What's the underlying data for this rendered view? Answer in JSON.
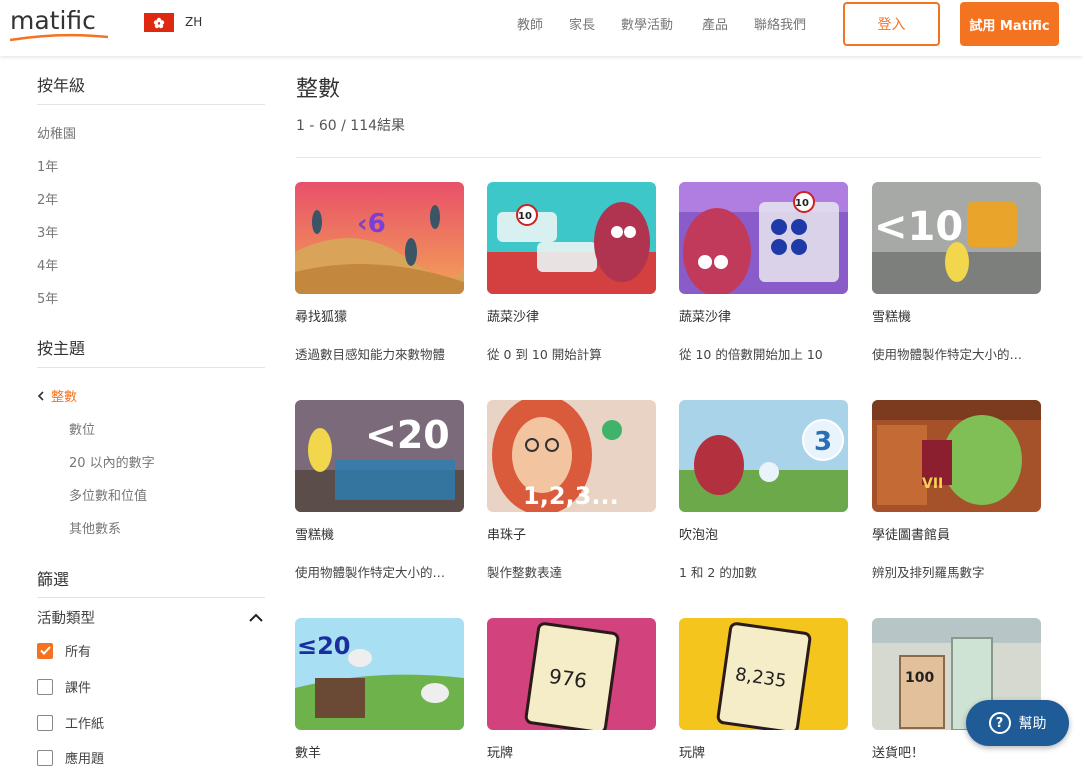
{
  "header": {
    "logo": "matific",
    "lang": "ZH",
    "nav": [
      "教師",
      "家長",
      "數學活動",
      "產品",
      "聯絡我們"
    ],
    "login_label": "登入",
    "try_label": "試用 Matific"
  },
  "sidebar": {
    "grade_heading": "按年級",
    "grades": [
      "幼稚園",
      "1年",
      "2年",
      "3年",
      "4年",
      "5年"
    ],
    "topic_heading": "按主題",
    "active_topic": "整數",
    "subtopics": [
      "數位",
      "20 以內的數字",
      "多位數和位值",
      "其他數系"
    ],
    "filter_heading": "篩選",
    "activity_type_label": "活動類型",
    "filters": [
      {
        "label": "所有",
        "checked": true
      },
      {
        "label": "課件",
        "checked": false
      },
      {
        "label": "工作紙",
        "checked": false
      },
      {
        "label": "應用題",
        "checked": false
      }
    ]
  },
  "main": {
    "title": "整數",
    "result_count": "1 - 60 / 114結果",
    "cards": [
      {
        "title": "尋找狐獴",
        "desc": "透過數目感知能力來數物體",
        "overlay_text": "‹6"
      },
      {
        "title": "蔬菜沙律",
        "desc": "從 0 到 10 開始計算",
        "overlay_text": "10"
      },
      {
        "title": "蔬菜沙律",
        "desc": "從 10 的倍數開始加上 10",
        "overlay_text": "10"
      },
      {
        "title": "雪糕機",
        "desc": "使用物體製作特定大小的…",
        "overlay_text": "<10"
      },
      {
        "title": "雪糕機",
        "desc": "使用物體製作特定大小的…",
        "overlay_text": "<20"
      },
      {
        "title": "串珠子",
        "desc": "製作整數表達",
        "overlay_text": "1,2,3..."
      },
      {
        "title": "吹泡泡",
        "desc": "1 和 2 的加數",
        "overlay_text": "3"
      },
      {
        "title": "學徒圖書館員",
        "desc": "辨別及排列羅馬數字",
        "overlay_text": "VII"
      },
      {
        "title": "數羊",
        "desc": "",
        "overlay_text": "≤20"
      },
      {
        "title": "玩牌",
        "desc": "",
        "overlay_text": "976"
      },
      {
        "title": "玩牌",
        "desc": "",
        "overlay_text": "8,235"
      },
      {
        "title": "送貨吧！",
        "desc": "",
        "overlay_text": "100"
      }
    ]
  },
  "help": {
    "label": "幫助",
    "icon": "?"
  },
  "colors": {
    "accent": "#f47321",
    "help_blue": "#1f5b96"
  }
}
